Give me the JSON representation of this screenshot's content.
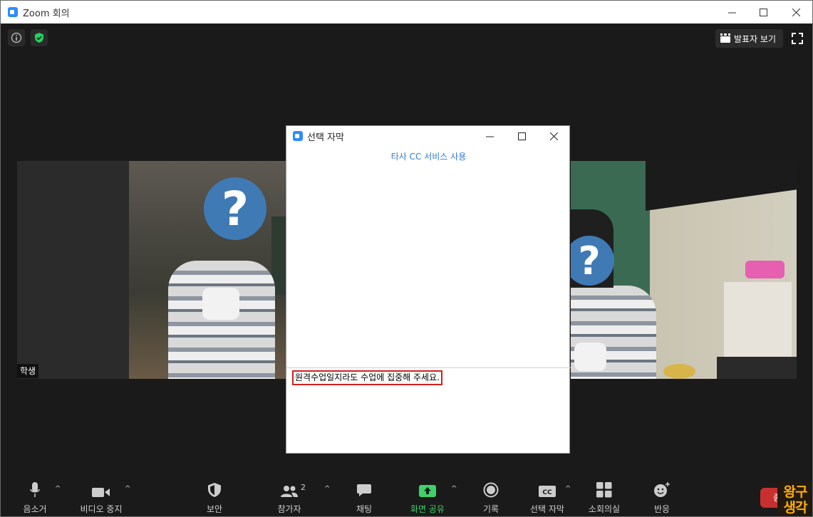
{
  "window": {
    "title": "Zoom 회의"
  },
  "top": {
    "speaker_view_label": "발표자 보기"
  },
  "tiles": {
    "left_name": "학생"
  },
  "dialog": {
    "title": "선택 자막",
    "third_party_cc_link": "타사 CC 서비스 사용",
    "caption_input_value": "원격수업일지라도 수업에 집중해 주세요."
  },
  "toolbar": {
    "mute_label": "음소거",
    "video_label": "비디오 중지",
    "security_label": "보안",
    "participants_label": "참가자",
    "participants_count": "2",
    "chat_label": "채팅",
    "share_label": "화면 공유",
    "record_label": "기록",
    "cc_label": "선택 자막",
    "breakout_label": "소회의실",
    "reactions_label": "반응",
    "end_label": "종"
  },
  "watermark": {
    "line1": "왕구",
    "line2": "생각"
  },
  "colors": {
    "accent": "#2d8cff",
    "share_green": "#3fd06b",
    "end_red": "#c8302f",
    "highlight_red": "#d32020"
  }
}
